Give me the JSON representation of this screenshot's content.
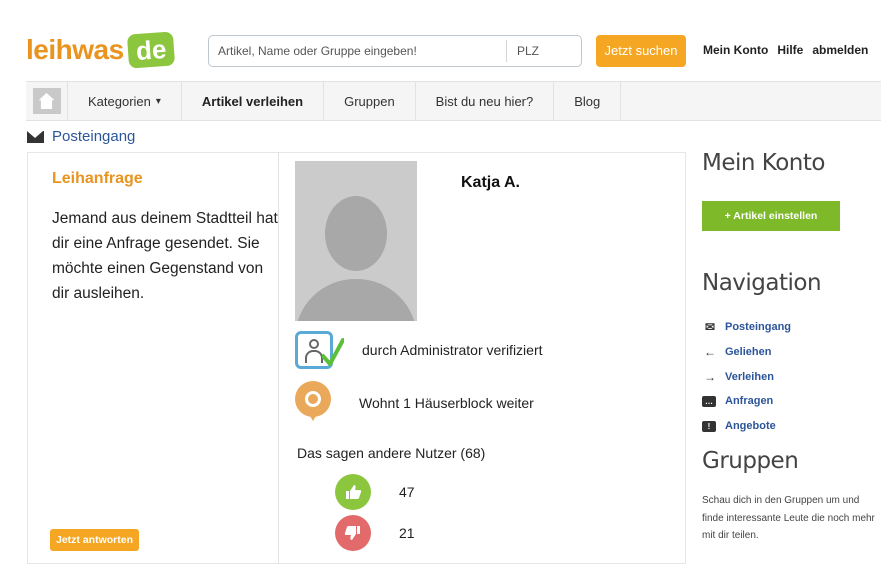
{
  "header": {
    "logo_text": "leihwas",
    "logo_badge": "de",
    "search_placeholder": "Artikel, Name oder Gruppe eingeben!",
    "plz_placeholder": "PLZ",
    "search_button": "Jetzt suchen",
    "links": [
      "Mein Konto",
      "Hilfe",
      "abmelden"
    ]
  },
  "nav": {
    "home_icon": "home-icon",
    "items": [
      {
        "label": "Kategorien",
        "chevron": "▾"
      },
      {
        "label": "Artikel verleihen"
      },
      {
        "label": "Gruppen"
      },
      {
        "label": "Bist du neu hier?"
      },
      {
        "label": "Blog"
      }
    ]
  },
  "breadcrumb": {
    "icon": "envelope-icon",
    "label": "Posteingang"
  },
  "request": {
    "title": "Leihanfrage",
    "body": "Jemand aus deinem Stadtteil hat dir eine Anfrage gesendet. Sie möchte einen Gegenstand von dir ausleihen.",
    "reply_button": "Jetzt antworten"
  },
  "profile": {
    "name": "Katja A.",
    "verified_text": "durch Administrator verifiziert",
    "location_text": "Wohnt 1 Häuserblock weiter",
    "reviews_title": "Das sagen andere Nutzer (68)",
    "positive": "47",
    "negative": "21"
  },
  "sidebar": {
    "account_heading": "Mein Konto",
    "add_button": "+ Artikel einstellen",
    "nav_heading": "Navigation",
    "nav_items": [
      {
        "label": "Posteingang",
        "icon": "envelope-icon"
      },
      {
        "label": "Geliehen",
        "icon": "arrow-left-icon"
      },
      {
        "label": "Verleihen",
        "icon": "arrow-right-icon"
      },
      {
        "label": "Anfragen",
        "icon": "speech-bubble-icon"
      },
      {
        "label": "Angebote",
        "icon": "exclamation-bubble-icon"
      }
    ],
    "groups_heading": "Gruppen",
    "groups_text": "Schau dich in den Gruppen um und finde interessante Leute die noch mehr mit dir teilen."
  },
  "colors": {
    "brand_orange": "#f5a623",
    "brand_green": "#8cc63f",
    "link_blue": "#2c5599"
  }
}
